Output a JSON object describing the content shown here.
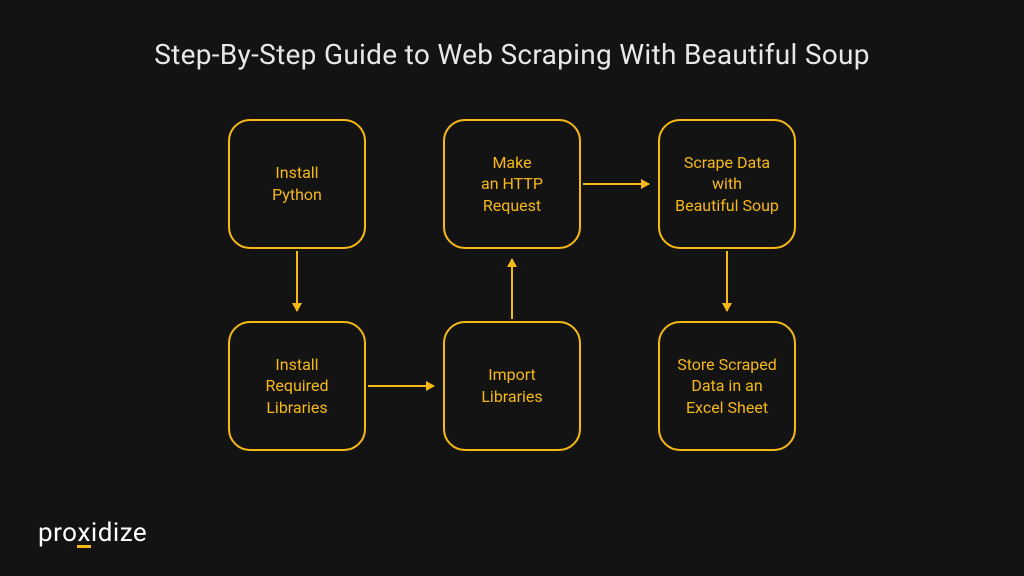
{
  "title": "Step-By-Step Guide to Web Scraping With Beautiful Soup",
  "boxes": {
    "step1": "Install\nPython",
    "step2": "Install\nRequired\nLibraries",
    "step3": "Import\nLibraries",
    "step4": "Make\nan HTTP\nRequest",
    "step5": "Scrape Data\nwith\nBeautiful Soup",
    "step6": "Store Scraped\nData in an\nExcel Sheet"
  },
  "logo": {
    "pre": "pro",
    "x": "x",
    "post": "idize"
  },
  "colors": {
    "background": "#131313",
    "accent": "#f5b817",
    "titleText": "#e8e8e8",
    "logoText": "#ffffff"
  }
}
